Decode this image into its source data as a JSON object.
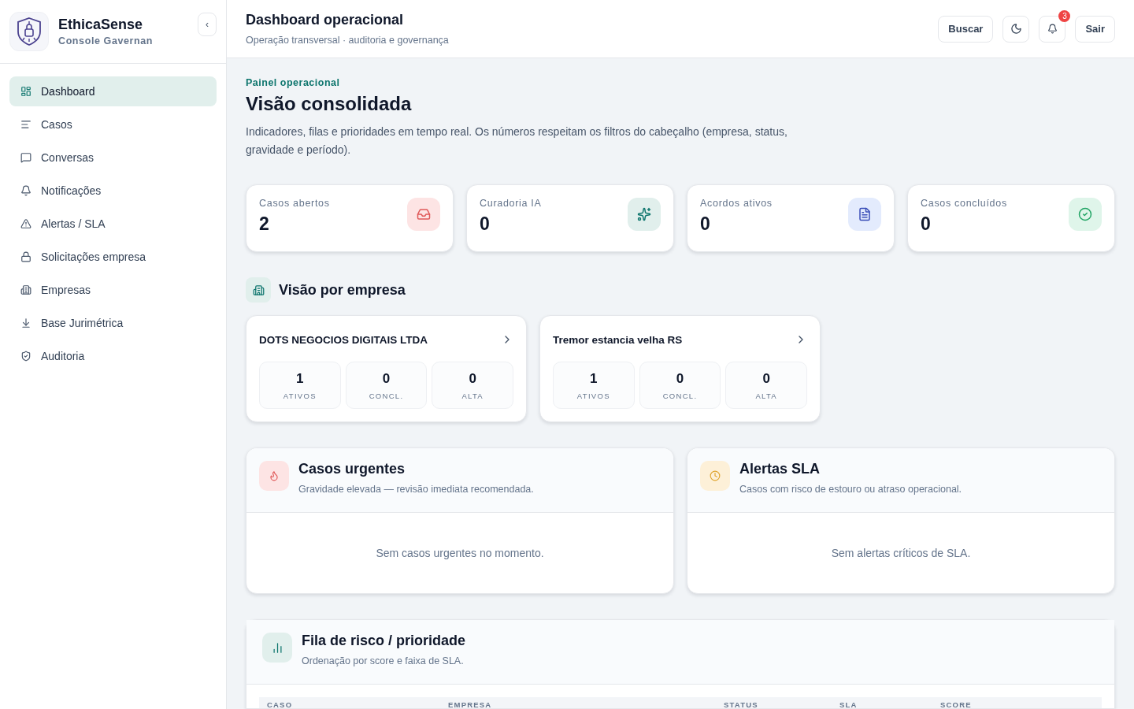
{
  "brand": {
    "name": "EthicaSense",
    "subtitle": "Console Gavernan",
    "collapse": "‹"
  },
  "sidebar": {
    "items": [
      {
        "label": "Dashboard",
        "kind": "dashboard",
        "selected": true
      },
      {
        "label": "Casos",
        "kind": "list",
        "selected": false
      },
      {
        "label": "Conversas",
        "kind": "chat",
        "selected": false
      },
      {
        "label": "Notificações",
        "kind": "bell",
        "selected": false
      },
      {
        "label": "Alertas / SLA",
        "kind": "alert",
        "selected": false
      },
      {
        "label": "Solicitações empresa",
        "kind": "lock",
        "selected": false
      },
      {
        "label": "Empresas",
        "kind": "building",
        "selected": false
      },
      {
        "label": "Base Jurimétrica",
        "kind": "download",
        "selected": false
      },
      {
        "label": "Auditoria",
        "kind": "shield",
        "selected": false
      }
    ]
  },
  "header": {
    "title": "Dashboard operacional",
    "subtitle": "Operação transversal · auditoria e governança",
    "search": "Buscar",
    "notifications": "3",
    "logout": "Sair"
  },
  "intro": {
    "eyebrow": "Painel operacional",
    "title": "Visão consolidada",
    "description": "Indicadores, filas e prioridades em tempo real. Os números respeitam os filtros do cabeçalho (empresa, status, gravidade e período)."
  },
  "stats": [
    {
      "label": "Casos abertos",
      "value": "2",
      "kind": "inbox"
    },
    {
      "label": "Curadoria IA",
      "value": "0",
      "kind": "sparkles"
    },
    {
      "label": "Acordos ativos",
      "value": "0",
      "kind": "document"
    },
    {
      "label": "Casos concluídos",
      "value": "0",
      "kind": "check"
    }
  ],
  "companies": {
    "title": "Visão por empresa",
    "items": [
      {
        "name": "DOTS NEGOCIOS DIGITAIS LTDA",
        "metrics": [
          {
            "value": "1",
            "label": "ATIVOS"
          },
          {
            "value": "0",
            "label": "CONCL."
          },
          {
            "value": "0",
            "label": "ALTA"
          }
        ]
      },
      {
        "name": "Tremor estancia velha RS",
        "metrics": [
          {
            "value": "1",
            "label": "ATIVOS"
          },
          {
            "value": "0",
            "label": "CONCL."
          },
          {
            "value": "0",
            "label": "ALTA"
          }
        ]
      }
    ]
  },
  "panels": [
    {
      "title": "Casos urgentes",
      "subtitle": "Gravidade elevada — revisão imediata recomendada.",
      "empty": "Sem casos urgentes no momento.",
      "kind": "urgent"
    },
    {
      "title": "Alertas SLA",
      "subtitle": "Casos com risco de estouro ou atraso operacional.",
      "empty": "Sem alertas críticos de SLA.",
      "kind": "sla"
    }
  ],
  "risk_queue": {
    "title": "Fila de risco / prioridade",
    "subtitle": "Ordenação por score e faixa de SLA.",
    "columns": [
      "CASO",
      "EMPRESA",
      "STATUS",
      "SLA",
      "SCORE"
    ]
  }
}
